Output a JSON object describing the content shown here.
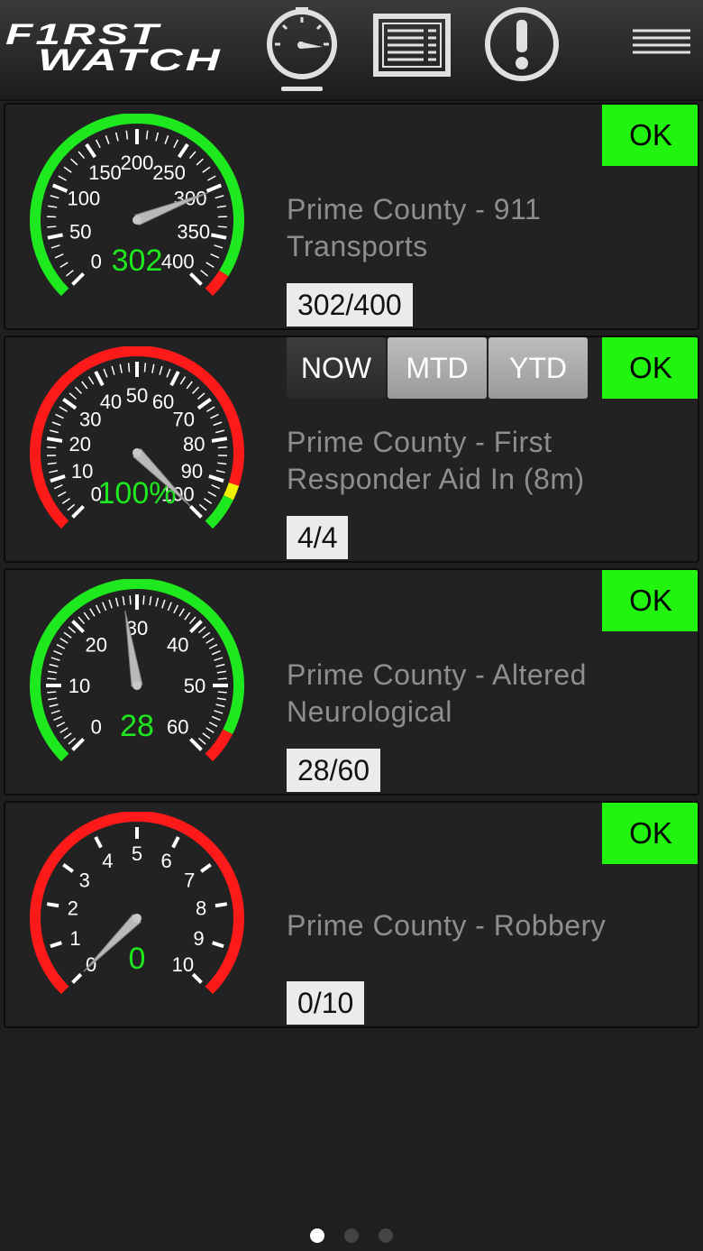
{
  "header": {
    "logo_line1": "F1RST",
    "logo_line2": "WATCH",
    "icons": [
      "gauge-icon",
      "report-icon",
      "alert-icon",
      "hamburger-menu-icon"
    ]
  },
  "cards": [
    {
      "title": "Prime County - 911 Transports",
      "value_text": "302/400",
      "status": "OK",
      "gauge": {
        "value": 302,
        "min": 0,
        "max": 400,
        "center_label": "302",
        "tick_labels": [
          "0",
          "50",
          "100",
          "150",
          "200",
          "250",
          "300",
          "350",
          "400"
        ],
        "major_step": 50,
        "minor_step": 10,
        "bands": [
          {
            "from": 0,
            "to": 380,
            "color": "#1ee81e"
          },
          {
            "from": 380,
            "to": 400,
            "color": "#ff1a1a"
          }
        ]
      }
    },
    {
      "title": "Prime County - First Responder Aid In (8m)",
      "value_text": "4/4",
      "status": "OK",
      "tabs": [
        "NOW",
        "MTD",
        "YTD"
      ],
      "active_tab": "NOW",
      "gauge": {
        "value": 100,
        "min": 0,
        "max": 100,
        "center_label": "100%",
        "tick_labels": [
          "0",
          "10",
          "20",
          "30",
          "40",
          "50",
          "60",
          "70",
          "80",
          "90",
          "100"
        ],
        "major_step": 10,
        "minor_step": 2,
        "bands": [
          {
            "from": 0,
            "to": 90,
            "color": "#ff1a1a"
          },
          {
            "from": 90,
            "to": 93,
            "color": "#f0f000"
          },
          {
            "from": 93,
            "to": 100,
            "color": "#1ee81e"
          }
        ]
      }
    },
    {
      "title": "Prime County - Altered Neurological",
      "value_text": "28/60",
      "status": "OK",
      "gauge": {
        "value": 28,
        "min": 0,
        "max": 60,
        "center_label": "28",
        "tick_labels": [
          "0",
          "10",
          "20",
          "30",
          "40",
          "50",
          "60"
        ],
        "major_step": 10,
        "minor_step": 1,
        "bands": [
          {
            "from": 0,
            "to": 56,
            "color": "#1ee81e"
          },
          {
            "from": 56,
            "to": 60,
            "color": "#ff1a1a"
          }
        ]
      }
    },
    {
      "title": "Prime County - Robbery",
      "value_text": "0/10",
      "status": "OK",
      "gauge": {
        "value": 0,
        "min": 0,
        "max": 10,
        "center_label": "0",
        "tick_labels": [
          "0",
          "1",
          "2",
          "3",
          "4",
          "5",
          "6",
          "7",
          "8",
          "9",
          "10"
        ],
        "major_step": 1,
        "minor_step": 0,
        "bands": [
          {
            "from": 0,
            "to": 10,
            "color": "#ff1a1a"
          }
        ]
      }
    }
  ],
  "pager": {
    "count": 3,
    "active": 0
  },
  "colors": {
    "ok_green": "#21f40f",
    "gauge_text_green": "#1ee81e",
    "title_gray": "#8e8e8e"
  }
}
